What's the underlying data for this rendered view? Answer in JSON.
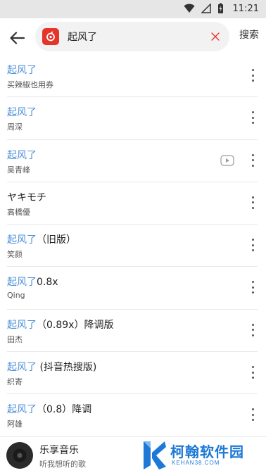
{
  "status_bar": {
    "time": "11:21",
    "icons": [
      "wifi-icon",
      "signal-icon",
      "battery-icon"
    ]
  },
  "header": {
    "back_icon": "arrow-left-icon",
    "app_icon": "netease-music-icon",
    "search_value": "起风了",
    "clear_icon": "close-icon",
    "search_label": "搜索"
  },
  "results": [
    {
      "highlight": "起风了",
      "rest": "",
      "artist": "买辣椒也用券",
      "mv": false
    },
    {
      "highlight": "起风了",
      "rest": "",
      "artist": "周深",
      "mv": false
    },
    {
      "highlight": "起风了",
      "rest": "",
      "artist": "吴青峰",
      "mv": true
    },
    {
      "highlight": "",
      "rest": "ヤキモチ",
      "artist": "高橋優",
      "mv": false
    },
    {
      "highlight": "起风了",
      "rest": "（旧版）",
      "artist": "笑颜",
      "mv": false
    },
    {
      "highlight": "起风了",
      "rest": "0.8x",
      "artist": "Qing",
      "mv": false
    },
    {
      "highlight": "起风了",
      "rest": "（0.89x）降调版",
      "artist": "田杰",
      "mv": false
    },
    {
      "highlight": "起风了",
      "rest": " (抖音热搜版)",
      "artist": "织寄",
      "mv": false
    },
    {
      "highlight": "起风了",
      "rest": "（0.8）降调",
      "artist": "阿雄",
      "mv": false
    }
  ],
  "player": {
    "title": "乐享音乐",
    "subtitle": "听我想听的歌"
  },
  "watermark": {
    "main": "柯翰软件园",
    "sub": "KEHAN38.COM"
  },
  "colors": {
    "highlight": "#4a8fd8",
    "app_badge": "#e5342a",
    "watermark": "#1e78d6"
  }
}
